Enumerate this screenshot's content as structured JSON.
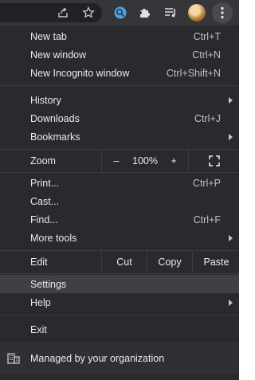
{
  "menu": {
    "group1": [
      {
        "label": "New tab",
        "accel": "Ctrl+T"
      },
      {
        "label": "New window",
        "accel": "Ctrl+N"
      },
      {
        "label": "New Incognito window",
        "accel": "Ctrl+Shift+N"
      }
    ],
    "group2": [
      {
        "label": "History",
        "accel": ""
      },
      {
        "label": "Downloads",
        "accel": "Ctrl+J"
      },
      {
        "label": "Bookmarks",
        "accel": ""
      }
    ],
    "zoom": {
      "label": "Zoom",
      "minus": "–",
      "value": "100%",
      "plus": "+"
    },
    "group3": [
      {
        "label": "Print...",
        "accel": "Ctrl+P"
      },
      {
        "label": "Cast...",
        "accel": ""
      },
      {
        "label": "Find...",
        "accel": "Ctrl+F"
      },
      {
        "label": "More tools",
        "accel": ""
      }
    ],
    "edit": {
      "label": "Edit",
      "cut": "Cut",
      "copy": "Copy",
      "paste": "Paste"
    },
    "group4": [
      {
        "label": "Settings"
      },
      {
        "label": "Help"
      }
    ],
    "exit": "Exit",
    "managed": "Managed by your organization"
  },
  "icons": {
    "share": "share-icon",
    "star": "star-icon",
    "extension_blue": "search-extension-icon",
    "puzzle": "extensions-icon",
    "reading_list": "reading-list-icon",
    "avatar": "profile-avatar",
    "menu": "more-vert-icon",
    "fullscreen": "fullscreen-icon",
    "building": "building-icon"
  },
  "colors": {
    "menu_bg": "#292a2d",
    "toolbar_bg": "#35363a",
    "highlight": "#3f4043",
    "text": "#e8eaed",
    "accent": "#4fa3e0"
  }
}
